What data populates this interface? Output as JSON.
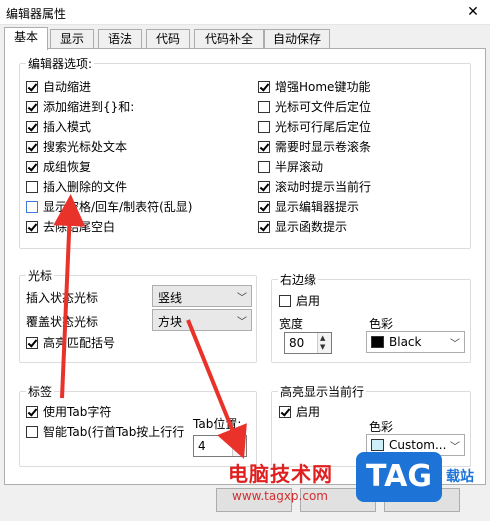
{
  "window": {
    "title": "编辑器属性",
    "close_glyph": "✕"
  },
  "tabs": [
    "基本",
    "显示",
    "语法",
    "代码",
    "代码补全",
    "自动保存"
  ],
  "editor_options": {
    "legend": "编辑器选项:",
    "left": [
      {
        "label": "自动缩进",
        "checked": true
      },
      {
        "label": "添加缩进到{}和:",
        "checked": true
      },
      {
        "label": "插入模式",
        "checked": true
      },
      {
        "label": "搜索光标处文本",
        "checked": true
      },
      {
        "label": "成组恢复",
        "checked": true
      },
      {
        "label": "插入删除的文件",
        "checked": false
      },
      {
        "label": "显示空格/回车/制表符(乱显)",
        "checked": false
      },
      {
        "label": "去除结尾空白",
        "checked": true
      }
    ],
    "right": [
      {
        "label": "增强Home键功能",
        "checked": true
      },
      {
        "label": "光标可文件后定位",
        "checked": false
      },
      {
        "label": "光标可行尾后定位",
        "checked": false
      },
      {
        "label": "需要时显示卷滚条",
        "checked": true
      },
      {
        "label": "半屏滚动",
        "checked": false
      },
      {
        "label": "滚动时提示当前行",
        "checked": true
      },
      {
        "label": "显示编辑器提示",
        "checked": true
      },
      {
        "label": "显示函数提示",
        "checked": true
      }
    ]
  },
  "cursor": {
    "legend": "光标",
    "insert_label": "插入状态光标",
    "insert_value": "竖线",
    "overwrite_label": "覆盖状态光标",
    "overwrite_value": "方块",
    "highlight_match": "高亮匹配括号"
  },
  "right_margin": {
    "legend": "右边缘",
    "enable": "启用",
    "width_label": "宽度",
    "width_value": "80",
    "color_label": "色彩",
    "color_value": "Black",
    "color_hex": "#000000"
  },
  "tabs_group": {
    "legend": "标签",
    "use_tab": "使用Tab字符",
    "smart_tab": "智能Tab(行首Tab按上行行",
    "tab_width_label": "Tab位置:",
    "tab_width_value": "4"
  },
  "highlight_line": {
    "legend": "高亮显示当前行",
    "enable": "启用",
    "color_label": "色彩",
    "color_value": "Custom...",
    "color_hex": "#cdeff7"
  },
  "watermark": {
    "cn": "电脑技术网",
    "url": "www.tagxp.com",
    "logo": "TAG",
    "side": "载站"
  },
  "colors": {
    "arrow": "#e8322a"
  }
}
